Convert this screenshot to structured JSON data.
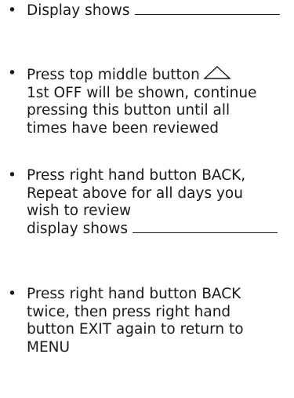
{
  "instructions": [
    {
      "lines": [
        "Display shows"
      ]
    },
    {
      "lines": [
        "Press top middle button",
        "1st OFF will be shown, continue",
        "pressing this button until all",
        "times have been reviewed"
      ],
      "icon": "up-triangle-icon"
    },
    {
      "lines": [
        "Press right hand button BACK,",
        "Repeat above for all days you",
        "wish to review",
        "display shows"
      ]
    },
    {
      "lines": [
        "Press right hand button BACK",
        "twice, then press right hand",
        "button EXIT again to return to",
        "MENU"
      ]
    }
  ],
  "bullet": "•"
}
